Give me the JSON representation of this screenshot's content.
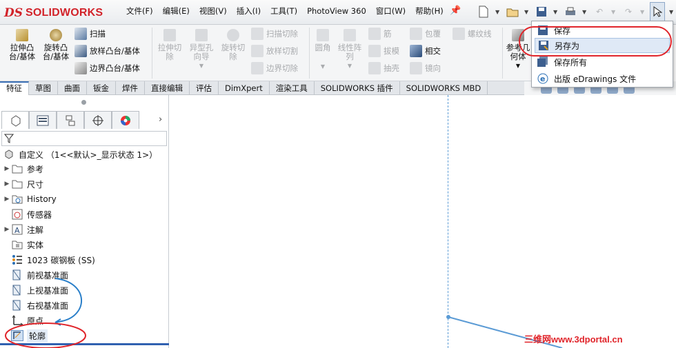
{
  "logo": {
    "ds": "DS",
    "text": "SOLIDWORKS"
  },
  "menu": [
    "文件(F)",
    "编辑(E)",
    "视图(V)",
    "插入(I)",
    "工具(T)",
    "PhotoView 360",
    "窗口(W)",
    "帮助(H)"
  ],
  "ribbon": {
    "extrude_boss": "拉伸凸\n台/基体",
    "revolve_boss": "旋转凸\n台/基体",
    "sweep": "扫描",
    "loft_boss": "放样凸台/基体",
    "boundary_boss": "边界凸台/基体",
    "extrude_cut": "拉伸切\n除",
    "hole_wizard": "异型孔\n向导",
    "revolve_cut": "旋转切\n除",
    "sweep_cut": "扫描切除",
    "loft_cut": "放样切割",
    "boundary_cut": "边界切除",
    "fillet": "圆角",
    "linear_pattern": "线性阵\n列",
    "rib": "筋",
    "draft": "拔模",
    "shell": "抽壳",
    "wrap": "包覆",
    "intersect": "相交",
    "mirror": "镜向",
    "helix": "螺纹线",
    "ref_geometry": "参考几\n何体"
  },
  "tabs": [
    "特征",
    "草图",
    "曲面",
    "钣金",
    "焊件",
    "直接编辑",
    "评估",
    "DimXpert",
    "渲染工具",
    "SOLIDWORKS 插件",
    "SOLIDWORKS MBD"
  ],
  "dropdown": {
    "items": [
      {
        "label": "保存",
        "icon": "save-icon"
      },
      {
        "label": "另存为",
        "icon": "save-as-icon"
      },
      {
        "label": "保存所有",
        "icon": "save-all-icon"
      },
      {
        "label": "出版 eDrawings 文件",
        "icon": "edrawings-icon"
      }
    ],
    "highlighted": "另存为"
  },
  "tree": {
    "root": "自定义 （1<<默认>_显示状态 1>）",
    "items": [
      {
        "label": "参考",
        "icon": "folder-icon",
        "expand": true
      },
      {
        "label": "尺寸",
        "icon": "folder-icon",
        "expand": true
      },
      {
        "label": "History",
        "icon": "history-icon",
        "expand": true
      },
      {
        "label": "传感器",
        "icon": "sensor-icon",
        "expand": false
      },
      {
        "label": "注解",
        "icon": "annotation-icon",
        "expand": true
      },
      {
        "label": "实体",
        "icon": "solid-body-icon",
        "expand": false
      },
      {
        "label": "1023 碳钢板 (SS)",
        "icon": "material-icon",
        "expand": false
      },
      {
        "label": "前视基准面",
        "icon": "plane-icon",
        "expand": false
      },
      {
        "label": "上视基准面",
        "icon": "plane-icon",
        "expand": false
      },
      {
        "label": "右视基准面",
        "icon": "plane-icon",
        "expand": false
      },
      {
        "label": "原点",
        "icon": "origin-icon",
        "expand": false
      },
      {
        "label": "轮廓",
        "icon": "sketch-icon",
        "expand": false
      }
    ]
  },
  "watermark": "三维网www.3dportal.cn",
  "colors": {
    "accent_red": "#e0242a",
    "brand_red": "#d2232a",
    "highlight_blue": "#dfe9f6",
    "sketch_blue": "#5b9bd5"
  }
}
